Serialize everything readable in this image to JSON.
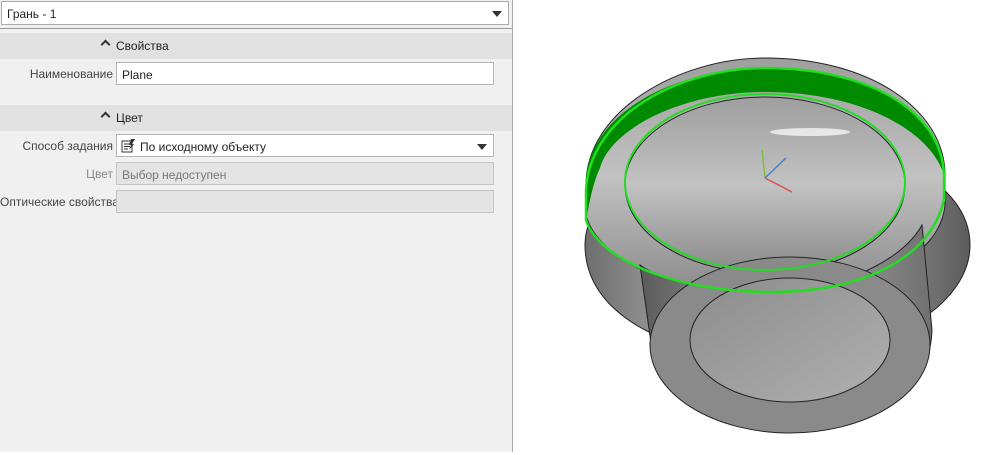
{
  "selector": {
    "value": "Грань - 1"
  },
  "sections": {
    "properties": {
      "title": "Свойства"
    },
    "color": {
      "title": "Цвет"
    }
  },
  "fields": {
    "name": {
      "label": "Наименование",
      "value": "Plane"
    },
    "method": {
      "label": "Способ задания",
      "value": "По исходному объекту"
    },
    "color": {
      "label": "Цвет",
      "value": "Выбор недоступен"
    },
    "optical": {
      "label": "Оптические свойства",
      "value": ""
    }
  },
  "colors": {
    "highlight": "#00c000",
    "face_fill": "#008a00",
    "model_grey": "#a8a8a8",
    "axis_x": "#e05050",
    "axis_y": "#7ac142",
    "axis_z": "#4a7fd0"
  }
}
